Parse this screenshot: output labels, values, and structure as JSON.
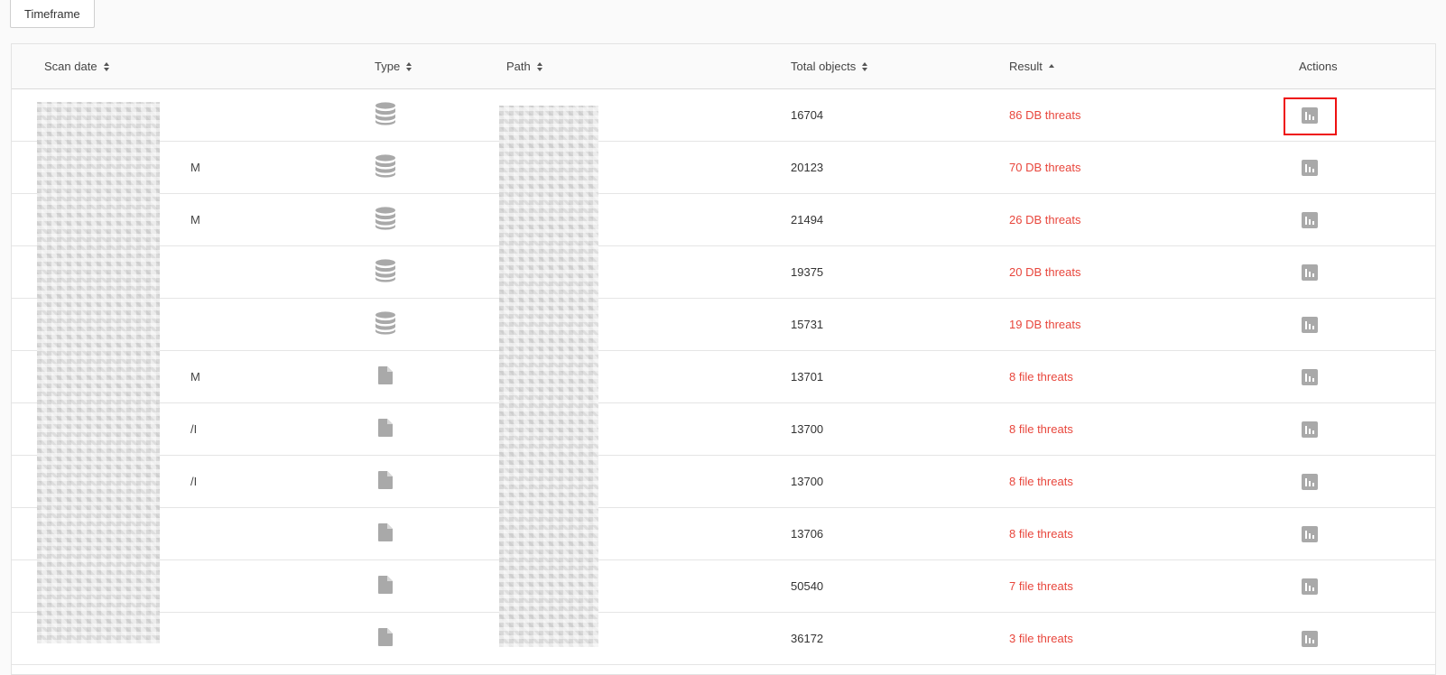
{
  "toolbar": {
    "timeframe_label": "Timeframe"
  },
  "table": {
    "columns": {
      "scan_date": "Scan date",
      "type": "Type",
      "path": "Path",
      "total_objects": "Total objects",
      "result": "Result",
      "actions": "Actions"
    },
    "sorted_column": "result",
    "sort_direction": "ascending",
    "rows": [
      {
        "date_suffix": "",
        "type_icon": "database-icon",
        "total": "16704",
        "result": "86 DB threats",
        "highlighted": true
      },
      {
        "date_suffix": "M",
        "type_icon": "database-icon",
        "total": "20123",
        "result": "70 DB threats"
      },
      {
        "date_suffix": "M",
        "type_icon": "database-icon",
        "total": "21494",
        "result": "26 DB threats"
      },
      {
        "date_suffix": "",
        "type_icon": "database-icon",
        "total": "19375",
        "result": "20 DB threats"
      },
      {
        "date_suffix": "",
        "type_icon": "database-icon",
        "total": "15731",
        "result": "19 DB threats"
      },
      {
        "date_suffix": "M",
        "type_icon": "file-icon",
        "total": "13701",
        "result": "8 file threats"
      },
      {
        "date_suffix": "/I",
        "type_icon": "file-icon",
        "total": "13700",
        "result": "8 file threats"
      },
      {
        "date_suffix": "/I",
        "type_icon": "file-icon",
        "total": "13700",
        "result": "8 file threats"
      },
      {
        "date_suffix": "",
        "type_icon": "file-icon",
        "total": "13706",
        "result": "8 file threats"
      },
      {
        "date_suffix": "",
        "type_icon": "file-icon",
        "total": "50540",
        "result": "7 file threats"
      },
      {
        "date_suffix": "",
        "type_icon": "file-icon",
        "total": "36172",
        "result": "3 file threats"
      }
    ]
  },
  "colors": {
    "threat": "#e8463c",
    "icon": "#a9a9a9",
    "highlight": "#ee1111"
  }
}
